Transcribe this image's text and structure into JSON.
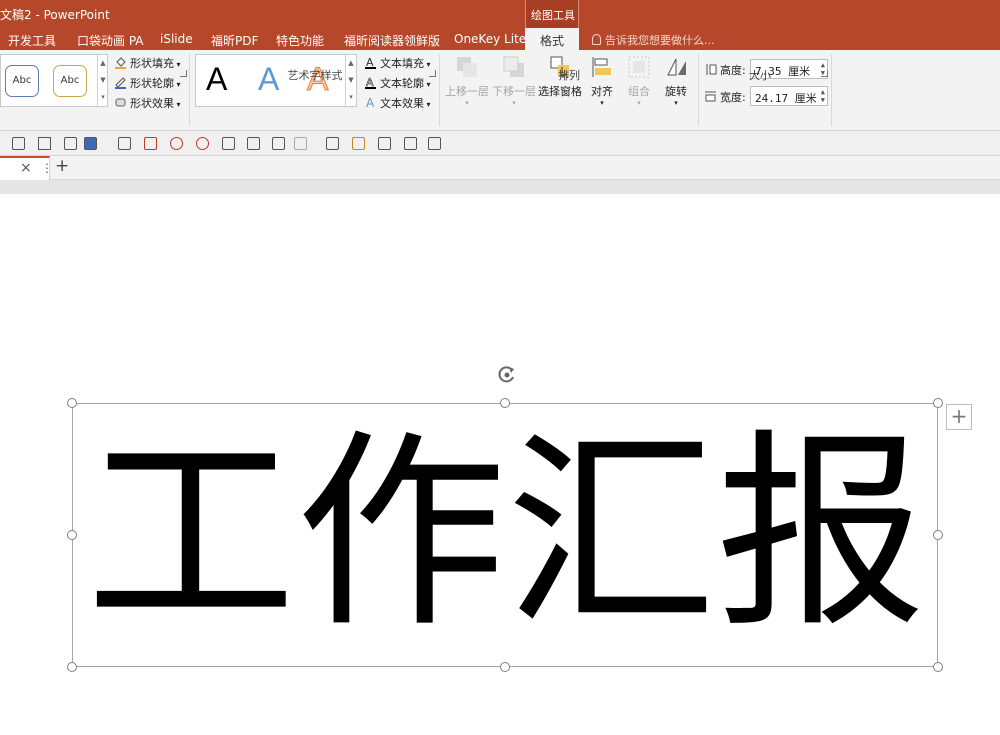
{
  "window": {
    "title": "文稿2 - PowerPoint",
    "context_group": "绘图工具"
  },
  "tabs": [
    {
      "id": "dev",
      "label": "开发工具"
    },
    {
      "id": "pocket",
      "label": "口袋动画 PA"
    },
    {
      "id": "islide",
      "label": "iSlide"
    },
    {
      "id": "foxit",
      "label": "福昕PDF"
    },
    {
      "id": "special",
      "label": "特色功能"
    },
    {
      "id": "reader",
      "label": "福昕阅读器领鲜版"
    },
    {
      "id": "onekey",
      "label": "OneKey Lite"
    }
  ],
  "active_tab": "格式",
  "tell_me": "告诉我您想要做什么...",
  "ribbon": {
    "shape_styles": {
      "sample1": "Abc",
      "sample2": "Abc",
      "fill": "形状填充",
      "outline": "形状轮廓",
      "effects": "形状效果"
    },
    "wordart": {
      "group_label": "艺术字样式",
      "letter": "A",
      "text_fill": "文本填充",
      "text_outline": "文本轮廓",
      "text_effects": "文本效果"
    },
    "arrange": {
      "group_label": "排列",
      "bring_forward": "上移一层",
      "send_backward": "下移一层",
      "selection_pane": "选择窗格",
      "align": "对齐",
      "group": "组合",
      "rotate": "旋转"
    },
    "size": {
      "group_label": "大小",
      "height_label": "高度:",
      "height_value": "7.35 厘米",
      "width_label": "宽度:",
      "width_value": "24.17 厘米"
    }
  },
  "slide": {
    "text": "工作汇报"
  },
  "colors": {
    "accent": "#b7472a",
    "active_tab_bg": "#f3f3f3",
    "doc_tab_accent": "#d24726"
  }
}
